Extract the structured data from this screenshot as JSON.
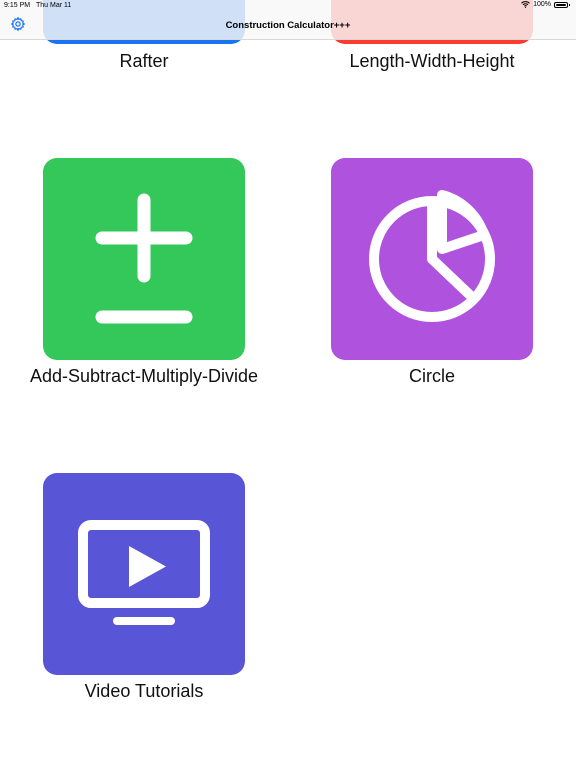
{
  "status_bar": {
    "time": "9:15 PM",
    "date": "Thu Mar 11",
    "battery": "100%"
  },
  "nav": {
    "title": "Construction Calculator+++",
    "settings_icon": "gear-icon"
  },
  "tiles": [
    {
      "label": "Rafter",
      "color": "#1a73f0"
    },
    {
      "label": "Length-Width-Height",
      "color": "#ff3b30"
    },
    {
      "label": "Add-Subtract-Multiply-Divide",
      "color": "#34c759",
      "icon": "plus-minus-icon"
    },
    {
      "label": "Circle",
      "color": "#af52de",
      "icon": "pie-chart-icon"
    },
    {
      "label": "Video Tutorials",
      "color": "#5856d6",
      "icon": "video-play-icon"
    }
  ]
}
